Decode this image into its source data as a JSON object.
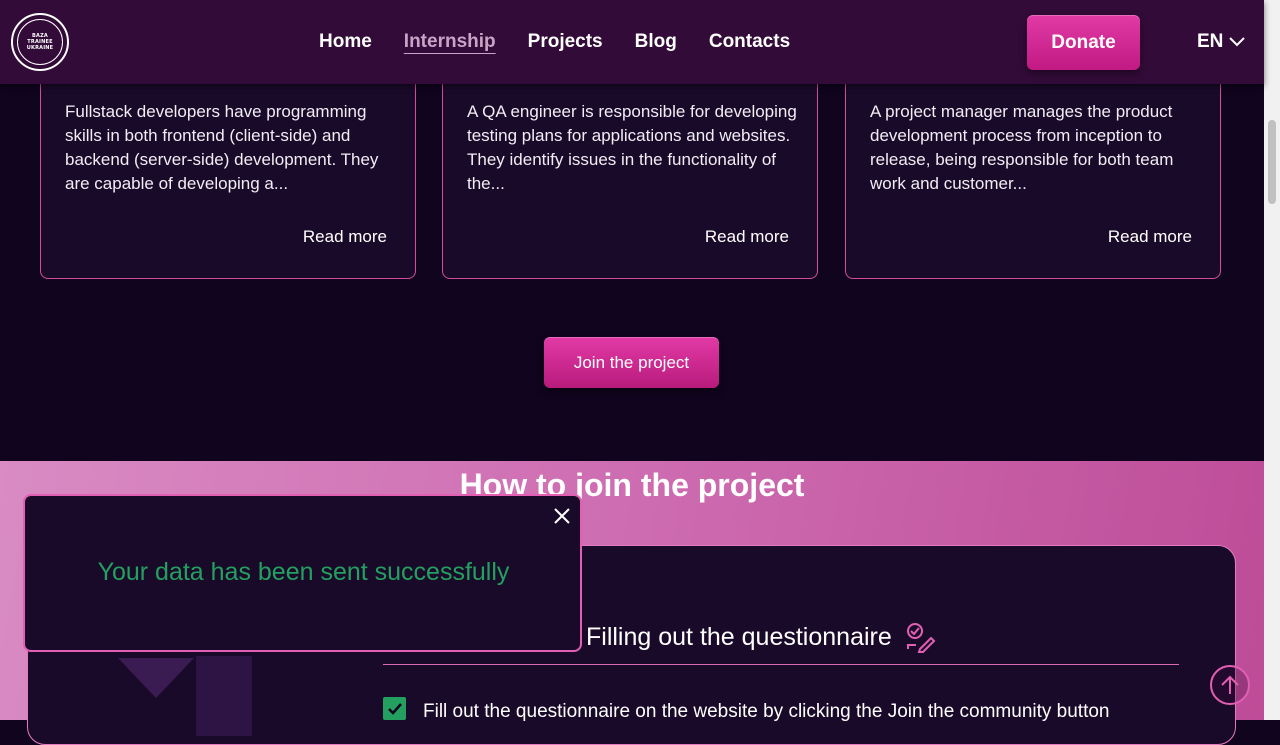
{
  "header": {
    "logo_text": "BAZA\nTRAINEE\nUKRAINE",
    "nav": [
      {
        "label": "Home"
      },
      {
        "label": "Internship"
      },
      {
        "label": "Projects"
      },
      {
        "label": "Blog"
      },
      {
        "label": "Contacts"
      }
    ],
    "active_nav": "Internship",
    "donate_label": "Donate",
    "language": "EN"
  },
  "cards": [
    {
      "text": "Fullstack developers have programming skills in both frontend (client-side) and backend (server-side) development. They are capable of developing a...",
      "link": "Read more"
    },
    {
      "text": "A QA engineer is responsible for developing testing plans for applications and websites. They identify issues in the functionality of the...",
      "link": "Read more"
    },
    {
      "text": "A project manager manages the product development process from inception to release, being responsible for both team work and customer...",
      "link": "Read more"
    }
  ],
  "join_button": "Join the project",
  "how_to_join": {
    "title": "How to join the project",
    "step_title": "Filling out the questionnaire",
    "step_item": "Fill out the questionnaire on the website by clicking the Join the community button"
  },
  "toast": {
    "message": "Your data has been sent successfully"
  },
  "colors": {
    "accent": "#e23aa6",
    "success": "#23a05f",
    "header_bg": "#330b38",
    "page_bg": "#10041f"
  }
}
